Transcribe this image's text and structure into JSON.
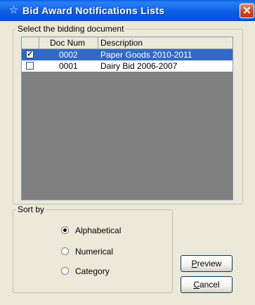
{
  "window": {
    "title": "Bid Award Notifications Lists",
    "icon": "star-outline-icon",
    "close_icon": "close-icon"
  },
  "select_group": {
    "label": "Select the bidding document",
    "columns": [
      "",
      "Doc Num",
      "Description"
    ],
    "rows": [
      {
        "checked": true,
        "doc_num": "0002",
        "description": "Paper Goods 2010-2011",
        "selected": true
      },
      {
        "checked": false,
        "doc_num": "0001",
        "description": "Dairy Bid 2006-2007",
        "selected": false
      }
    ]
  },
  "sort_group": {
    "label": "Sort by",
    "options": [
      {
        "label": "Alphabetical",
        "checked": true
      },
      {
        "label": "Numerical",
        "checked": false
      },
      {
        "label": "Category",
        "checked": false
      }
    ]
  },
  "buttons": {
    "preview": {
      "mnemonic": "P",
      "rest": "review"
    },
    "cancel": {
      "mnemonic": "C",
      "rest": "ancel"
    }
  },
  "colors": {
    "titlebar": "#0b5fe6",
    "selection": "#316ac5",
    "dialog_bg": "#ece9d8",
    "close": "#d3491f"
  }
}
